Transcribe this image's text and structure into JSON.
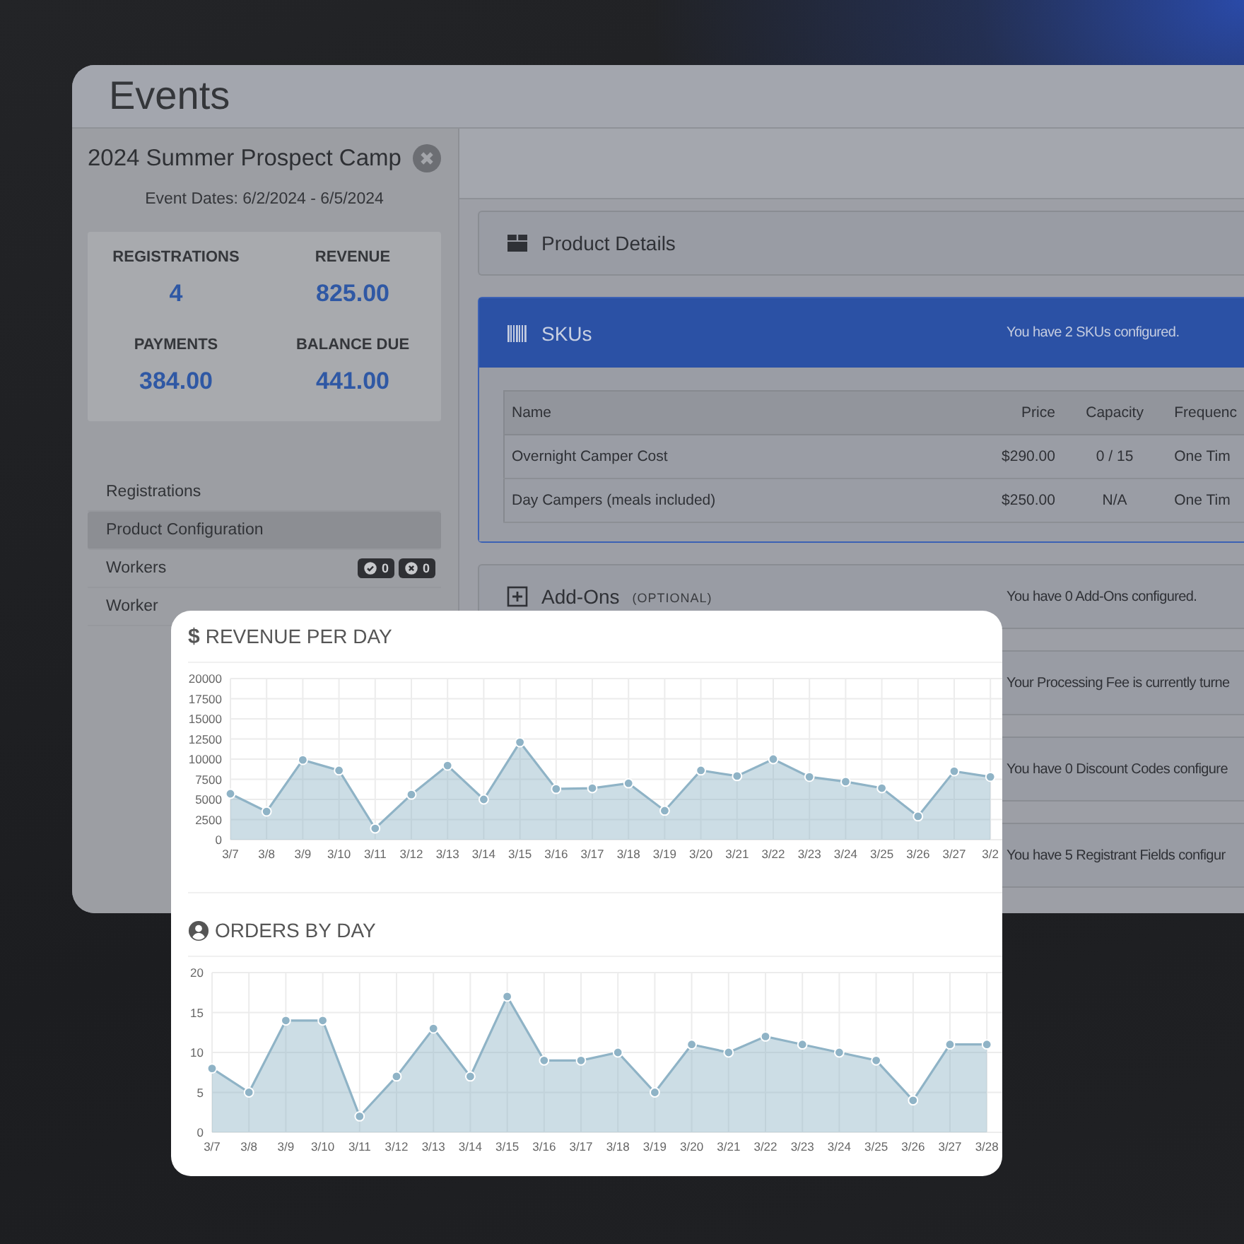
{
  "window": {
    "title": "Events"
  },
  "event": {
    "title": "2024 Summer Prospect Camp",
    "dates": "Event Dates: 6/2/2024 - 6/5/2024"
  },
  "stats": [
    {
      "label": "REGISTRATIONS",
      "value": "4"
    },
    {
      "label": "REVENUE",
      "value": "825.00"
    },
    {
      "label": "PAYMENTS",
      "value": "384.00"
    },
    {
      "label": "BALANCE DUE",
      "value": "441.00"
    }
  ],
  "nav": [
    {
      "label": "Registrations",
      "selected": false
    },
    {
      "label": "Product Configuration",
      "selected": true
    },
    {
      "label": "Workers",
      "selected": false,
      "badges": [
        {
          "kind": "approved",
          "count": "0"
        },
        {
          "kind": "declined",
          "count": "0"
        }
      ]
    },
    {
      "label": "Worker",
      "selected": false
    }
  ],
  "panels": [
    {
      "kind": "product",
      "title": "Product Details",
      "expanded": false
    },
    {
      "kind": "skus",
      "title": "SKUs",
      "message": "You have 2 SKUs configured.",
      "expanded": true,
      "table": {
        "columns": [
          "Name",
          "Price",
          "Capacity",
          "Frequenc"
        ],
        "rows": [
          [
            "Overnight Camper Cost",
            "$290.00",
            "0 / 15",
            "One Tim"
          ],
          [
            "Day Campers (meals included)",
            "$250.00",
            "N/A",
            "One Tim"
          ]
        ]
      }
    },
    {
      "kind": "addons",
      "title": "Add-Ons",
      "note": "(OPTIONAL)",
      "message": "You have 0 Add-Ons configured.",
      "expanded": false
    },
    {
      "kind": "hidden",
      "message": "Your Processing Fee is currently turne"
    },
    {
      "kind": "hidden",
      "message": "You have 0 Discount Codes configure"
    },
    {
      "kind": "hidden",
      "message": "You have 5 Registrant Fields configur"
    }
  ],
  "charts": [
    {
      "kind": "revenue",
      "symbol": "$",
      "chart_data": {
        "type": "area",
        "grid": true,
        "title": "REVENUE PER DAY",
        "categories": [
          "3/7",
          "3/8",
          "3/9",
          "3/10",
          "3/11",
          "3/12",
          "3/13",
          "3/14",
          "3/15",
          "3/16",
          "3/17",
          "3/18",
          "3/19",
          "3/20",
          "3/21",
          "3/22",
          "3/23",
          "3/24",
          "3/25",
          "3/26",
          "3/27",
          "3/2"
        ],
        "ylim": [
          0,
          20000
        ],
        "yticks": [
          0,
          2500,
          5000,
          7500,
          10000,
          12500,
          15000,
          17500,
          20000
        ],
        "series": [
          {
            "color": "#8fb3c6",
            "values": [
              5700,
              3500,
              9900,
              8600,
              1400,
              5600,
              9200,
              5000,
              12100,
              6300,
              6400,
              7000,
              3600,
              8600,
              7900,
              10000,
              7800,
              7200,
              6400,
              2900,
              8500,
              7800
            ]
          }
        ]
      }
    },
    {
      "kind": "orders",
      "chart_data": {
        "type": "area",
        "grid": true,
        "title": "ORDERS BY DAY",
        "categories": [
          "3/7",
          "3/8",
          "3/9",
          "3/10",
          "3/11",
          "3/12",
          "3/13",
          "3/14",
          "3/15",
          "3/16",
          "3/17",
          "3/18",
          "3/19",
          "3/20",
          "3/21",
          "3/22",
          "3/23",
          "3/24",
          "3/25",
          "3/26",
          "3/27",
          "3/28"
        ],
        "ylim": [
          0,
          20
        ],
        "yticks": [
          0,
          5,
          10,
          15,
          20
        ],
        "series": [
          {
            "color": "#8fb3c6",
            "values": [
              8,
              5,
              14,
              14,
              2,
              7,
              13,
              7,
              17,
              9,
              9,
              10,
              5,
              11,
              10,
              12,
              11,
              10,
              9,
              4,
              11,
              11
            ]
          }
        ]
      }
    }
  ]
}
